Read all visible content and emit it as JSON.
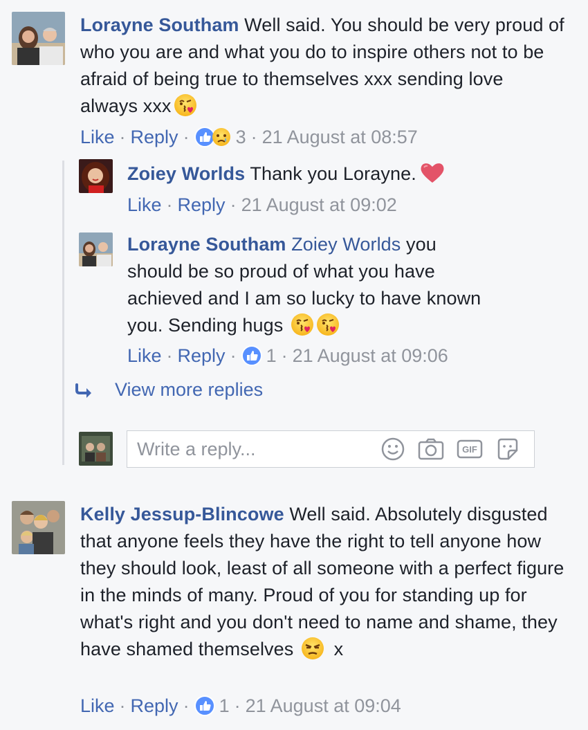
{
  "comments": [
    {
      "author": "Lorayne Southam",
      "text": "Well said. You should be very proud of who you are and what you do to inspire others not to be afraid of being true to themselves xxx sending love always xxx",
      "emoji": "kissing-heart",
      "like": "Like",
      "reply": "Reply",
      "reaction_count": "3",
      "time": "21 August at 08:57"
    },
    {
      "author": "Kelly Jessup-Blincowe",
      "text": "Well said. Absolutely disgusted that anyone feels they have the right to tell anyone how they should look, least of all someone with a perfect figure in the minds of many. Proud of you for standing up for what's right and you don't need to name and shame, they have shamed themselves",
      "emoji": "unamused",
      "trailing": "x",
      "like": "Like",
      "reply": "Reply",
      "reaction_count": "1",
      "time": "21 August at 09:04"
    }
  ],
  "replies": [
    {
      "author": "Zoiey Worlds",
      "text": "Thank you Lorayne.",
      "emoji": "heart",
      "like": "Like",
      "reply": "Reply",
      "time": "21 August at 09:02"
    },
    {
      "author": "Lorayne Southam",
      "mention": "Zoiey Worlds",
      "text": "you should be so proud of what you have achieved and I am so lucky to have known you. Sending hugs",
      "emoji": "kissing-heart",
      "like": "Like",
      "reply": "Reply",
      "reaction_count": "1",
      "time": "21 August at 09:06"
    }
  ],
  "view_more": "View more replies",
  "reply_box": {
    "placeholder": "Write a reply...",
    "icons": [
      "smiley-icon",
      "camera-icon",
      "gif-icon",
      "sticker-icon"
    ],
    "gif_label": "GIF"
  },
  "colors": {
    "link": "#365899",
    "action": "#4267b2",
    "meta": "#90949c",
    "background": "#f6f7f9"
  }
}
